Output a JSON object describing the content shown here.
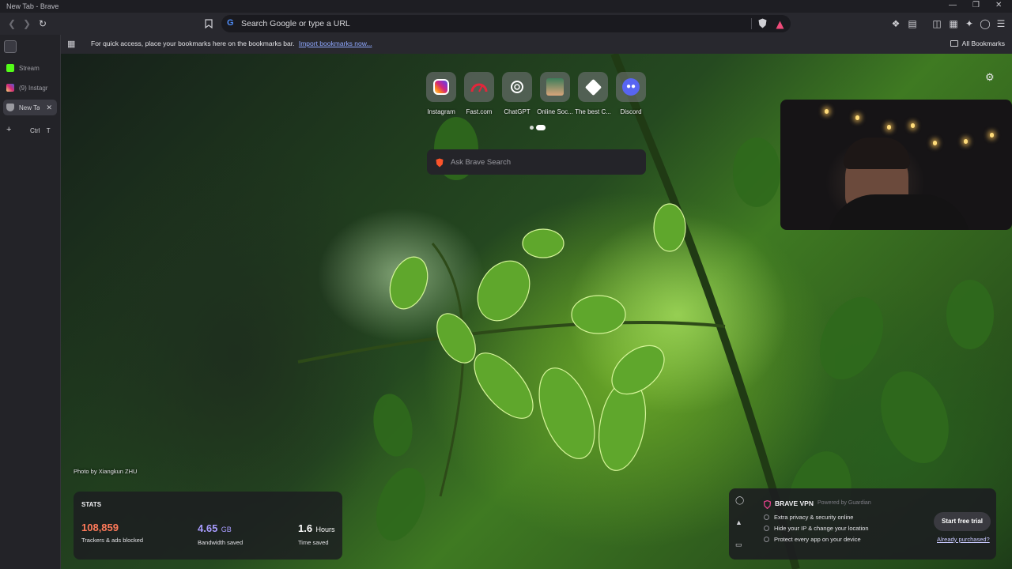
{
  "window": {
    "title": "New Tab - Brave"
  },
  "toolbar": {
    "url_placeholder": "Search Google or type a URL"
  },
  "bookmarks_bar": {
    "message": "For quick access, place your bookmarks here on the bookmarks bar.",
    "import_link": "Import bookmarks now...",
    "all_bookmarks": "All Bookmarks"
  },
  "sidebar": {
    "tabs": [
      {
        "label": "Stream",
        "icon": "kick-icon",
        "color": "#53fc18"
      },
      {
        "label": "(9) Instagr",
        "icon": "instagram-icon",
        "color": "#e1306c"
      },
      {
        "label": "New Tab",
        "icon": "brave-shield-icon",
        "color": "#9a9aa0"
      }
    ],
    "new_tab_shortcut": {
      "ctrl": "Ctrl",
      "key": "T"
    }
  },
  "top_sites": [
    {
      "name": "Instagram",
      "icon": "instagram-icon"
    },
    {
      "name": "Fast.com",
      "icon": "speedometer-icon"
    },
    {
      "name": "ChatGPT",
      "icon": "openai-icon"
    },
    {
      "name": "Online Soc...",
      "icon": "avatar-icon"
    },
    {
      "name": "The best C...",
      "icon": "diamond-icon"
    },
    {
      "name": "Discord",
      "icon": "discord-icon"
    }
  ],
  "search": {
    "placeholder": "Ask Brave Search"
  },
  "photo_credit": "Photo by Xiangkun ZHU",
  "stats": {
    "heading": "STATS",
    "trackers": {
      "value": "108,859",
      "label": "Trackers & ads blocked",
      "color": "#ff7a5a"
    },
    "bandwidth": {
      "value": "4.65",
      "unit": "GB",
      "label": "Bandwidth saved",
      "color": "#a89cff"
    },
    "time": {
      "value": "1.6",
      "unit": "Hours",
      "label": "Time saved",
      "color": "#ffffff"
    }
  },
  "vpn": {
    "title": "BRAVE VPN",
    "powered_by": "Powered by Guardian",
    "features": [
      "Extra privacy & security online",
      "Hide your IP & change your location",
      "Protect every app on your device"
    ],
    "cta": "Start free trial",
    "purchased": "Already purchased?"
  },
  "colors": {
    "accent": "#fb542b",
    "brand_shield": "#f1573f"
  }
}
